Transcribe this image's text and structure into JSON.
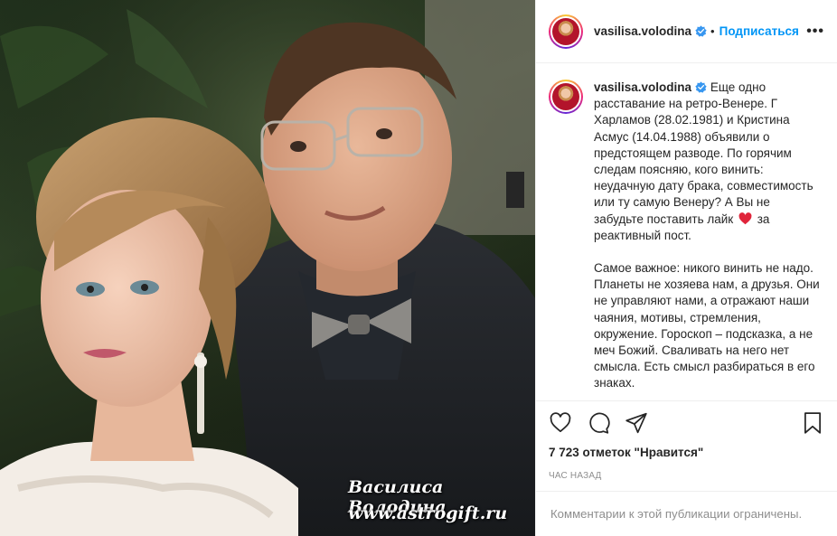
{
  "photo": {
    "watermark_name": "Василиса Володина",
    "watermark_site": "www.astrogift.ru"
  },
  "header": {
    "username": "vasilisa.volodina",
    "separator": "•",
    "follow_label": "Подписаться",
    "more_label": "•••"
  },
  "caption": {
    "username": "vasilisa.volodina",
    "paragraph1_before_heart": "Еще одно расставание на ретро-Венере. Г Харламов (28.02.1981) и Кристина Асмус (14.04.1988) объявили о предстоящем разводе. По горячим следам поясняю, кого винить: неудачную дату брака, совместимость или ту самую Венеру? А Вы не забудьте поставить лайк",
    "paragraph1_after_heart": "за реактивный пост.",
    "paragraph2": "Самое важное: никого винить не надо. Планеты не хозяева нам, а друзья. Они не управляют нами, а отражают наши чаяния, мотивы, стремления, окружение. Гороскоп – подсказка, а не меч Божий. Сваливать на него нет смысла. Есть смысл разбираться в его знаках."
  },
  "actions": {
    "icons": [
      "heart-icon",
      "comment-icon",
      "share-icon",
      "bookmark-icon"
    ]
  },
  "likes_text": "7 723 отметок \"Нравится\"",
  "time_text": "час назад",
  "comments_limited_text": "Комментарии к этой публикации ограничены.",
  "colors": {
    "link_blue": "#0095f6",
    "verified_blue": "#3897f0",
    "heart_red": "#ed4956",
    "muted_gray": "#8e8e8e"
  }
}
